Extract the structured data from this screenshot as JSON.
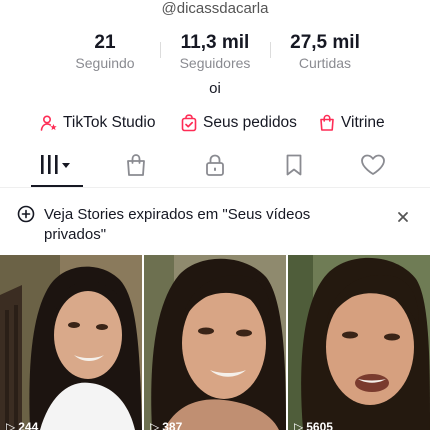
{
  "profile": {
    "handle": "@dicassdacarla",
    "bio": "oi"
  },
  "stats": [
    {
      "value": "21",
      "label": "Seguindo"
    },
    {
      "value": "11,3 mil",
      "label": "Seguidores"
    },
    {
      "value": "27,5 mil",
      "label": "Curtidas"
    }
  ],
  "links": [
    {
      "label": "TikTok Studio",
      "icon": "person-star-icon"
    },
    {
      "label": "Seus pedidos",
      "icon": "order-bag-icon"
    },
    {
      "label": "Vitrine",
      "icon": "shopping-bag-icon"
    }
  ],
  "tabs": [
    {
      "icon": "videos-grid-icon",
      "active": true
    },
    {
      "icon": "shop-bag-icon"
    },
    {
      "icon": "lock-icon"
    },
    {
      "icon": "bookmark-icon"
    },
    {
      "icon": "heart-icon"
    }
  ],
  "banner": {
    "text": "Veja Stories expirados em \"Seus vídeos privados\""
  },
  "videos": [
    {
      "views": "244"
    },
    {
      "views": "387"
    },
    {
      "views": "5605"
    }
  ],
  "colors": {
    "accent": "#fe2c55",
    "text": "#161823",
    "muted": "#8a8b91"
  }
}
